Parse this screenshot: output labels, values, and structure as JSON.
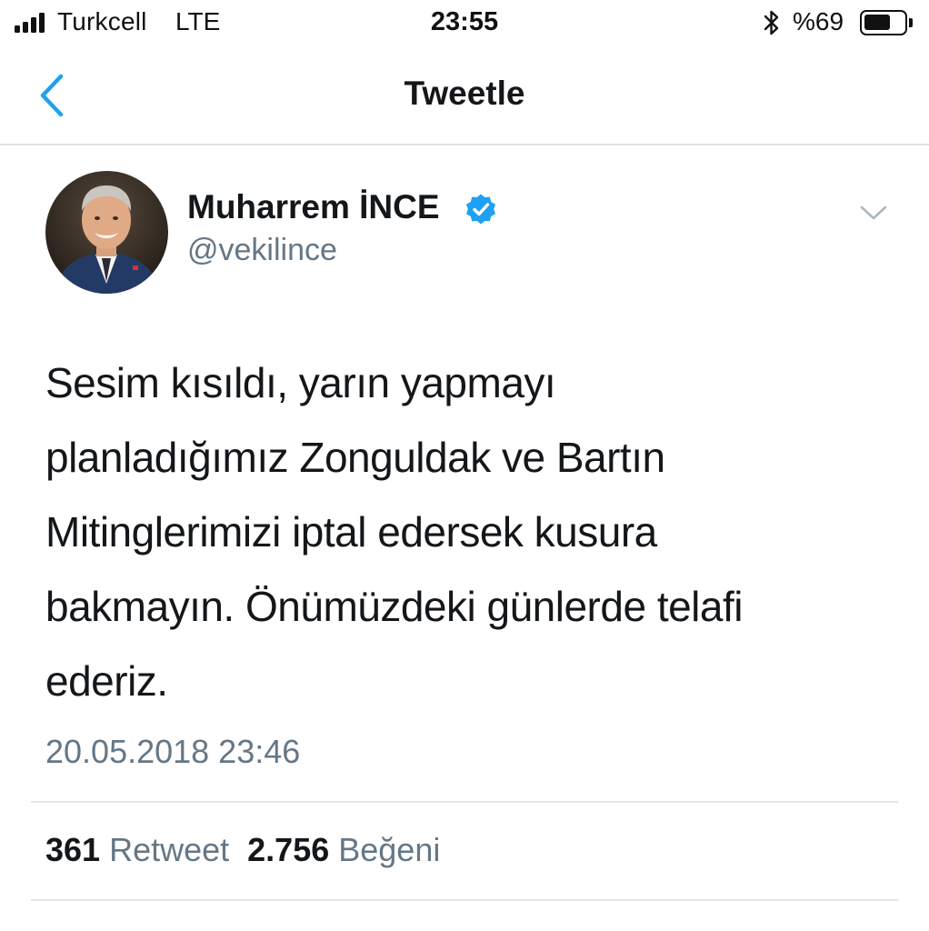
{
  "status_bar": {
    "carrier": "Turkcell",
    "network": "LTE",
    "time": "23:55",
    "battery_percent": "%69",
    "battery_level": 0.69,
    "icons": [
      "signal-icon",
      "bluetooth-icon",
      "battery-icon"
    ]
  },
  "nav": {
    "title": "Tweetle",
    "back_icon": "chevron-left-icon"
  },
  "tweet": {
    "author_name": "Muharrem İNCE",
    "handle": "@vekilince",
    "verified": true,
    "text_lines": [
      "Sesim kısıldı, yarın yapmayı",
      "planladığımız Zonguldak ve Bartın",
      "Mitinglerimizi iptal edersek kusura",
      "bakmayın. Önümüzdeki günlerde telafi",
      "ederiz."
    ],
    "timestamp": "20.05.2018 23:46",
    "retweet_count": "361",
    "retweet_label": "Retweet",
    "like_count": "2.756",
    "like_label": "Beğeni"
  },
  "colors": {
    "accent": "#1da1f2",
    "text": "#14171a",
    "secondary_text": "#657786",
    "divider": "#e1e8ed"
  }
}
